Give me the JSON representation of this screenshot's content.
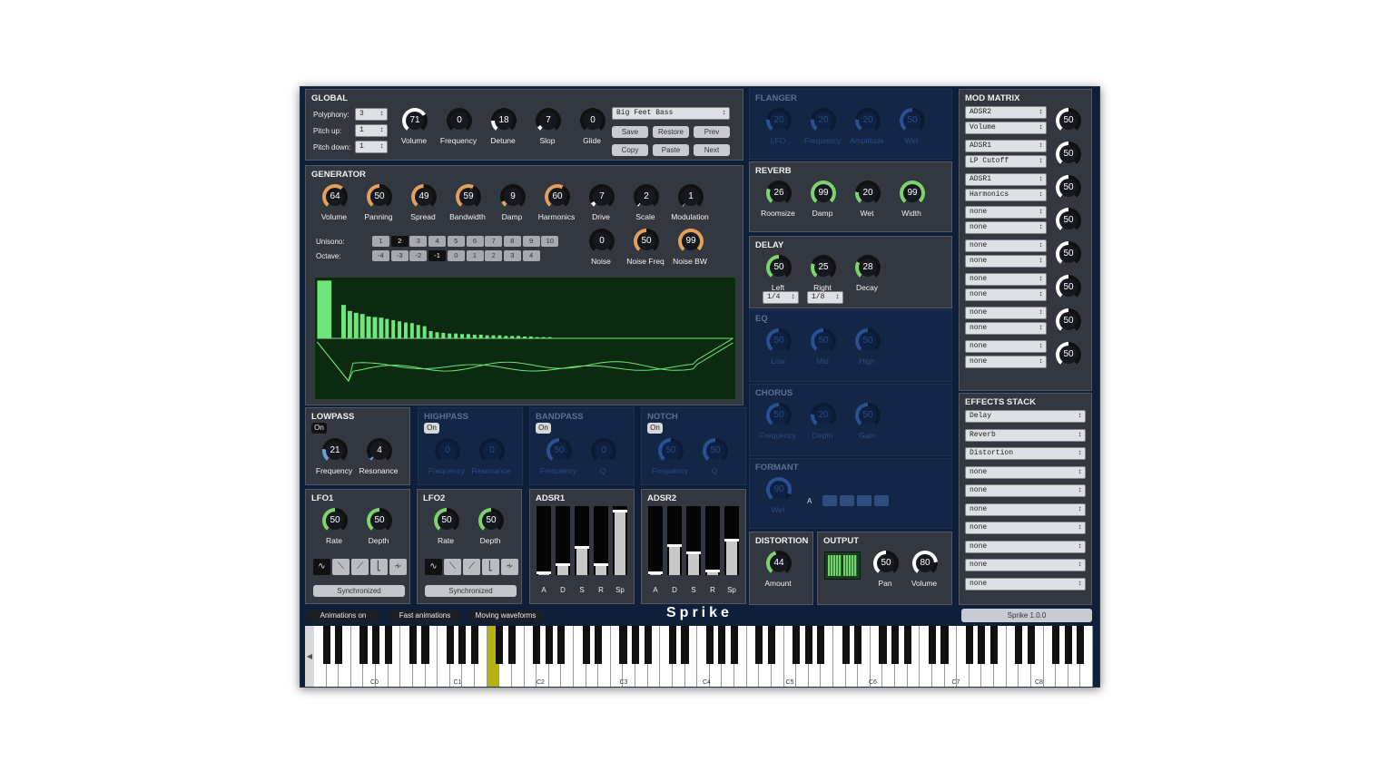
{
  "global": {
    "title": "GLOBAL",
    "polyphony_label": "Polyphony:",
    "polyphony": "3",
    "pitch_up_label": "Pitch up:",
    "pitch_up": "1",
    "pitch_down_label": "Pitch down:",
    "pitch_down": "1",
    "knobs": [
      {
        "label": "Volume",
        "value": 71
      },
      {
        "label": "Frequency",
        "value": 0
      },
      {
        "label": "Detune",
        "value": 18
      },
      {
        "label": "Slop",
        "value": 7
      },
      {
        "label": "Glide",
        "value": 0
      }
    ],
    "preset": "Big Feet Bass",
    "buttons": [
      "Save",
      "Restore",
      "Prev",
      "Copy",
      "Paste",
      "Next"
    ]
  },
  "generator": {
    "title": "GENERATOR",
    "knobs": [
      {
        "label": "Volume",
        "value": 64
      },
      {
        "label": "Panning",
        "value": 50
      },
      {
        "label": "Spread",
        "value": 49
      },
      {
        "label": "Bandwidth",
        "value": 59
      },
      {
        "label": "Damp",
        "value": 9
      },
      {
        "label": "Harmonics",
        "value": 60
      },
      {
        "label": "Drive",
        "value": 7
      },
      {
        "label": "Scale",
        "value": 2
      },
      {
        "label": "Modulation",
        "value": 1
      }
    ],
    "unisono_label": "Unisono:",
    "unisono": [
      "1",
      "2",
      "3",
      "4",
      "5",
      "6",
      "7",
      "8",
      "9",
      "10"
    ],
    "unisono_active": "2",
    "octave_label": "Octave:",
    "octave": [
      "-4",
      "-3",
      "-2",
      "-1",
      "0",
      "1",
      "2",
      "3",
      "4"
    ],
    "octave_active": "-1",
    "noise_knobs": [
      {
        "label": "Noise",
        "value": 0
      },
      {
        "label": "Noise Freq",
        "value": 50
      },
      {
        "label": "Noise BW",
        "value": 99
      }
    ]
  },
  "filters": [
    {
      "title": "LOWPASS",
      "on": "On",
      "knobs": [
        {
          "label": "Frequency",
          "value": 21
        },
        {
          "label": "Resonance",
          "value": 4
        }
      ]
    },
    {
      "title": "HIGHPASS",
      "on": "On",
      "knobs": [
        {
          "label": "Frequency",
          "value": 0
        },
        {
          "label": "Resonance",
          "value": 0
        }
      ]
    },
    {
      "title": "BANDPASS",
      "on": "On",
      "knobs": [
        {
          "label": "Frequency",
          "value": 50
        },
        {
          "label": "Q",
          "value": 0
        }
      ]
    },
    {
      "title": "NOTCH",
      "on": "On",
      "knobs": [
        {
          "label": "Frequency",
          "value": 50
        },
        {
          "label": "Q",
          "value": 50
        }
      ]
    }
  ],
  "lfos": [
    {
      "title": "LFO1",
      "knobs": [
        {
          "label": "Rate",
          "value": 50
        },
        {
          "label": "Depth",
          "value": 50
        }
      ],
      "sync": "Synchronized"
    },
    {
      "title": "LFO2",
      "knobs": [
        {
          "label": "Rate",
          "value": 50
        },
        {
          "label": "Depth",
          "value": 50
        }
      ],
      "sync": "Synchronized"
    }
  ],
  "adsrs": [
    {
      "title": "ADSR1",
      "labels": [
        "A",
        "D",
        "S",
        "R",
        "Sp"
      ],
      "levels": [
        0.03,
        0.15,
        0.4,
        0.15,
        0.92
      ]
    },
    {
      "title": "ADSR2",
      "labels": [
        "A",
        "D",
        "S",
        "R",
        "Sp"
      ],
      "levels": [
        0.03,
        0.42,
        0.32,
        0.05,
        0.5
      ]
    }
  ],
  "flanger": {
    "title": "FLANGER",
    "knobs": [
      {
        "label": "LFO",
        "value": 20
      },
      {
        "label": "Frequency",
        "value": 20
      },
      {
        "label": "Amplitude",
        "value": 20
      },
      {
        "label": "Wet",
        "value": 50
      }
    ]
  },
  "reverb": {
    "title": "REVERB",
    "knobs": [
      {
        "label": "Roomsize",
        "value": 26
      },
      {
        "label": "Damp",
        "value": 99
      },
      {
        "label": "Wet",
        "value": 20
      },
      {
        "label": "Width",
        "value": 99
      }
    ]
  },
  "delay": {
    "title": "DELAY",
    "knobs": [
      {
        "label": "Left",
        "value": 50
      },
      {
        "label": "Right",
        "value": 25
      },
      {
        "label": "Decay",
        "value": 28
      }
    ],
    "left_sync": "1/4",
    "right_sync": "1/8"
  },
  "eq": {
    "title": "EQ",
    "knobs": [
      {
        "label": "Low",
        "value": 50
      },
      {
        "label": "Mid",
        "value": 50
      },
      {
        "label": "High",
        "value": 50
      }
    ]
  },
  "chorus": {
    "title": "CHORUS",
    "knobs": [
      {
        "label": "Frequency",
        "value": 50
      },
      {
        "label": "Depth",
        "value": 20
      },
      {
        "label": "Gain",
        "value": 50
      }
    ]
  },
  "formant": {
    "title": "FORMANT",
    "knob": {
      "label": "Wet",
      "value": 90
    },
    "vowel_label": "A"
  },
  "distortion": {
    "title": "DISTORTION",
    "knob": {
      "label": "Amount",
      "value": 44
    }
  },
  "output": {
    "title": "OUTPUT",
    "knobs": [
      {
        "label": "Pan",
        "value": 50
      },
      {
        "label": "Volume",
        "value": 80
      }
    ]
  },
  "mod_matrix": {
    "title": "MOD MATRIX",
    "rows": [
      {
        "source": "ADSR2",
        "target": "Volume",
        "amount": 50
      },
      {
        "source": "ADSR1",
        "target": "LP Cutoff",
        "amount": 50
      },
      {
        "source": "ADSR1",
        "target": "Harmonics",
        "amount": 50
      },
      {
        "source": "none",
        "target": "none",
        "amount": 50
      },
      {
        "source": "none",
        "target": "none",
        "amount": 50
      },
      {
        "source": "none",
        "target": "none",
        "amount": 50
      },
      {
        "source": "none",
        "target": "none",
        "amount": 50
      },
      {
        "source": "none",
        "target": "none",
        "amount": 50
      }
    ]
  },
  "effects_stack": {
    "title": "EFFECTS STACK",
    "items": [
      "Delay",
      "Reverb",
      "Distortion",
      "none",
      "none",
      "none",
      "none",
      "none",
      "none",
      "none"
    ]
  },
  "bottom": {
    "animations": "Animations on",
    "fast": "Fast animations",
    "moving": "Moving waveforms",
    "logo": "Sprike",
    "version": "Sprike 1.0.0"
  },
  "keyboard": {
    "octave_labels": [
      "C0",
      "C1",
      "C2",
      "C3",
      "C4",
      "C5",
      "C6",
      "C7",
      "C8"
    ],
    "highlight_key": "C2"
  },
  "colors": {
    "bg": "#0f1f3a",
    "panel": "#33373f",
    "knob_orange": "#e2a05a",
    "knob_green": "#7cd46a",
    "knob_gray": "#ffffff",
    "spectrum": "#6fe57d",
    "highlight_key": "#b8b10f"
  },
  "spectrum": {
    "harmonics": [
      0.95,
      0.55,
      0.45,
      0.42,
      0.4,
      0.36,
      0.35,
      0.34,
      0.32,
      0.3,
      0.28,
      0.26,
      0.25,
      0.22,
      0.2,
      0.12,
      0.1,
      0.09,
      0.08,
      0.08,
      0.07,
      0.07,
      0.06,
      0.06,
      0.05,
      0.05,
      0.05,
      0.04,
      0.04,
      0.04,
      0.03,
      0.03,
      0.02,
      0.02,
      0.02
    ]
  }
}
